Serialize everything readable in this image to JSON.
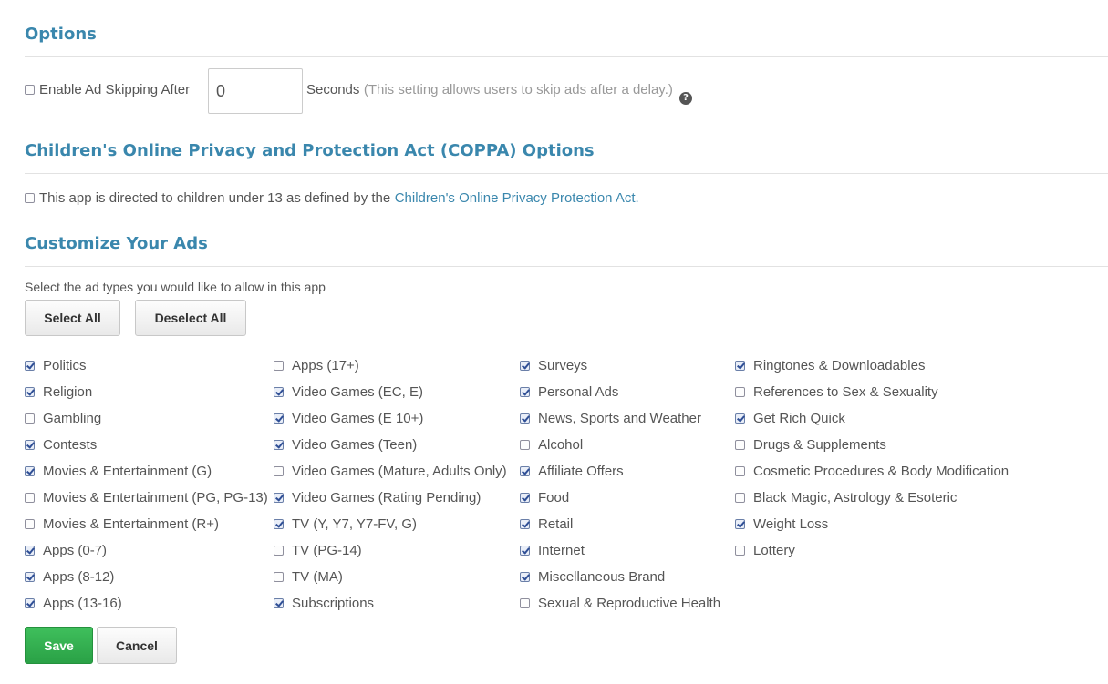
{
  "options": {
    "title": "Options",
    "ad_skip_label": "Enable Ad Skipping After",
    "ad_skip_checked": false,
    "seconds_value": "0",
    "seconds_label": "Seconds",
    "seconds_hint": "(This setting allows users to skip ads after a delay.)",
    "help_glyph": "?"
  },
  "coppa": {
    "title": "Children's Online Privacy and Protection Act (COPPA) Options",
    "checked": false,
    "text": "This app is directed to children under 13 as defined by the",
    "link_text": "Children's Online Privacy Protection Act."
  },
  "customize": {
    "title": "Customize Your Ads",
    "instruction": "Select the ad types you would like to allow in this app",
    "select_all_label": "Select All",
    "deselect_all_label": "Deselect All",
    "columns": [
      [
        {
          "label": "Politics",
          "checked": true
        },
        {
          "label": "Religion",
          "checked": true
        },
        {
          "label": "Gambling",
          "checked": false
        },
        {
          "label": "Contests",
          "checked": true
        },
        {
          "label": "Movies & Entertainment (G)",
          "checked": true
        },
        {
          "label": "Movies & Entertainment (PG, PG-13)",
          "checked": false
        },
        {
          "label": "Movies & Entertainment (R+)",
          "checked": false
        },
        {
          "label": "Apps (0-7)",
          "checked": true
        },
        {
          "label": "Apps (8-12)",
          "checked": true
        },
        {
          "label": "Apps (13-16)",
          "checked": true
        }
      ],
      [
        {
          "label": "Apps (17+)",
          "checked": false
        },
        {
          "label": "Video Games (EC, E)",
          "checked": true
        },
        {
          "label": "Video Games (E 10+)",
          "checked": true
        },
        {
          "label": "Video Games (Teen)",
          "checked": true
        },
        {
          "label": "Video Games (Mature, Adults Only)",
          "checked": false
        },
        {
          "label": "Video Games (Rating Pending)",
          "checked": true
        },
        {
          "label": "TV (Y, Y7, Y7-FV, G)",
          "checked": true
        },
        {
          "label": "TV (PG-14)",
          "checked": false
        },
        {
          "label": "TV (MA)",
          "checked": false
        },
        {
          "label": "Subscriptions",
          "checked": true
        }
      ],
      [
        {
          "label": "Surveys",
          "checked": true
        },
        {
          "label": "Personal Ads",
          "checked": true
        },
        {
          "label": "News, Sports and Weather",
          "checked": true
        },
        {
          "label": "Alcohol",
          "checked": false
        },
        {
          "label": "Affiliate Offers",
          "checked": true
        },
        {
          "label": "Food",
          "checked": true
        },
        {
          "label": "Retail",
          "checked": true
        },
        {
          "label": "Internet",
          "checked": true
        },
        {
          "label": "Miscellaneous Brand",
          "checked": true
        },
        {
          "label": "Sexual & Reproductive Health",
          "checked": false
        }
      ],
      [
        {
          "label": "Ringtones & Downloadables",
          "checked": true
        },
        {
          "label": "References to Sex & Sexuality",
          "checked": false
        },
        {
          "label": "Get Rich Quick",
          "checked": true
        },
        {
          "label": "Drugs & Supplements",
          "checked": false
        },
        {
          "label": "Cosmetic Procedures & Body Modification",
          "checked": false
        },
        {
          "label": "Black Magic, Astrology & Esoteric",
          "checked": false
        },
        {
          "label": "Weight Loss",
          "checked": true
        },
        {
          "label": "Lottery",
          "checked": false
        }
      ]
    ]
  },
  "footer": {
    "save_label": "Save",
    "cancel_label": "Cancel"
  },
  "colors": {
    "heading": "#3a87ad",
    "link": "#3a87ad",
    "save_button": "#2aa146",
    "text": "#555555",
    "muted": "#999999"
  }
}
